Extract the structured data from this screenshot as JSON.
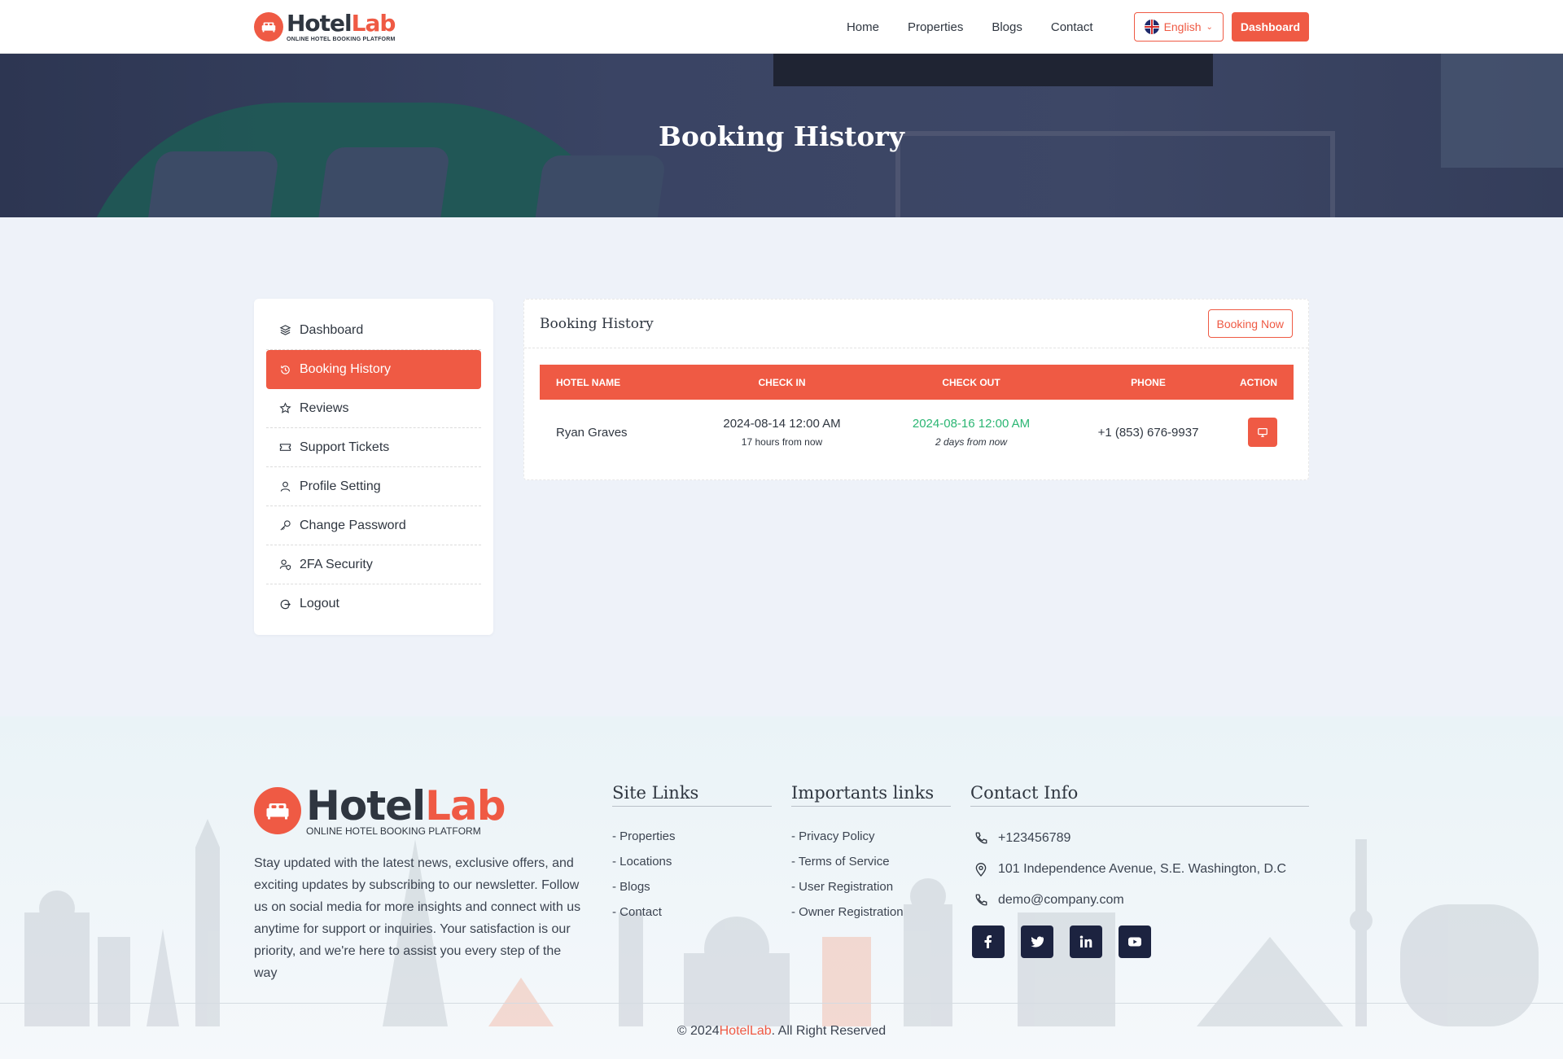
{
  "brand": {
    "name_part1": "Hotel",
    "name_part2": "Lab",
    "tagline": "ONLINE HOTEL BOOKING PLATFORM",
    "accent_color": "#ef5a44",
    "dark_color": "#1c2340"
  },
  "nav": {
    "links": [
      "Home",
      "Properties",
      "Blogs",
      "Contact"
    ],
    "language": "English",
    "dashboard_label": "Dashboard"
  },
  "hero": {
    "title": "Booking History"
  },
  "sidebar": {
    "items": [
      {
        "label": "Dashboard",
        "icon": "layers-icon",
        "active": false
      },
      {
        "label": "Booking History",
        "icon": "history-icon",
        "active": true
      },
      {
        "label": "Reviews",
        "icon": "star-icon",
        "active": false
      },
      {
        "label": "Support Tickets",
        "icon": "ticket-icon",
        "active": false
      },
      {
        "label": "Profile Setting",
        "icon": "user-icon",
        "active": false
      },
      {
        "label": "Change Password",
        "icon": "key-icon",
        "active": false
      },
      {
        "label": "2FA Security",
        "icon": "user-shield-icon",
        "active": false
      },
      {
        "label": "Logout",
        "icon": "logout-icon",
        "active": false
      }
    ]
  },
  "booking": {
    "title": "Booking History",
    "book_now_label": "Booking Now",
    "columns": [
      "HOTEL NAME",
      "CHECK IN",
      "CHECK OUT",
      "PHONE",
      "ACTION"
    ],
    "rows": [
      {
        "hotel_name": "Ryan Graves",
        "check_in": "2024-08-14 12:00 AM",
        "check_in_relative": "17 hours from now",
        "check_out": "2024-08-16 12:00 AM",
        "check_out_relative": "2 days from now",
        "phone": "+1 (853) 676-9937",
        "action_icon": "monitor-icon"
      }
    ]
  },
  "footer": {
    "description": "Stay updated with the latest news, exclusive offers, and exciting updates by subscribing to our newsletter. Follow us on social media for more insights and connect with us anytime for support or inquiries. Your satisfaction is our priority, and we're here to assist you every step of the way",
    "site_links_title": "Site Links",
    "site_links": [
      "- Properties",
      "- Locations",
      "- Blogs",
      "- Contact"
    ],
    "important_links_title": "Importants links",
    "important_links": [
      "- Privacy Policy",
      "- Terms of Service",
      "- User Registration",
      "- Owner Registration"
    ],
    "contact_title": "Contact Info",
    "phone": "+123456789",
    "address": "101 Independence Avenue, S.E. Washington, D.C",
    "email": "demo@company.com",
    "socials": [
      "facebook-icon",
      "twitter-icon",
      "linkedin-icon",
      "youtube-icon"
    ],
    "copyright_prefix": "© 2024 ",
    "copyright_brand": "HotelLab",
    "copyright_suffix": ". All Right Reserved"
  }
}
